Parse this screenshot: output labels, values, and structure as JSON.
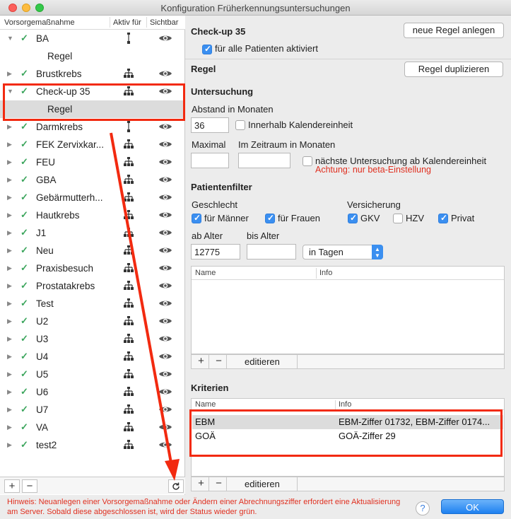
{
  "window": {
    "title": "Konfiguration Früherkennungsuntersuchungen"
  },
  "list_header": {
    "col_name": "Vorsorgemaßnahme",
    "col_active": "Aktiv für",
    "col_visible": "Sichtbar"
  },
  "list_items": [
    {
      "label": "BA",
      "expanded": true,
      "checked": true,
      "active_icon": "single-line-icon",
      "indent": false
    },
    {
      "label": "Regel",
      "child": true
    },
    {
      "label": "Brustkrebs",
      "checked": true,
      "active_icon": "tree-icon"
    },
    {
      "label": "Check-up 35",
      "expanded": true,
      "checked": true,
      "active_icon": "tree-icon"
    },
    {
      "label": "Regel",
      "child": true,
      "selected": true
    },
    {
      "label": "Darmkrebs",
      "checked": true,
      "active_icon": "single-line-icon"
    },
    {
      "label": "FEK Zervixkar...",
      "checked": true,
      "active_icon": "tree-icon"
    },
    {
      "label": "FEU",
      "checked": true,
      "active_icon": "tree-icon"
    },
    {
      "label": "GBA",
      "checked": true,
      "active_icon": "tree-icon"
    },
    {
      "label": "Gebärmutterh...",
      "checked": true,
      "active_icon": "tree-icon"
    },
    {
      "label": "Hautkrebs",
      "checked": true,
      "active_icon": "tree-icon"
    },
    {
      "label": "J1",
      "checked": true,
      "active_icon": "tree-icon"
    },
    {
      "label": "Neu",
      "checked": true,
      "active_icon": "tree-icon"
    },
    {
      "label": "Praxisbesuch",
      "checked": true,
      "active_icon": "tree-icon"
    },
    {
      "label": "Prostatakrebs",
      "checked": true,
      "active_icon": "tree-icon"
    },
    {
      "label": "Test",
      "checked": true,
      "active_icon": "tree-icon"
    },
    {
      "label": "U2",
      "checked": true,
      "active_icon": "tree-icon"
    },
    {
      "label": "U3",
      "checked": true,
      "active_icon": "tree-icon"
    },
    {
      "label": "U4",
      "checked": true,
      "active_icon": "tree-icon"
    },
    {
      "label": "U5",
      "checked": true,
      "active_icon": "tree-icon"
    },
    {
      "label": "U6",
      "checked": true,
      "active_icon": "tree-icon"
    },
    {
      "label": "U7",
      "checked": true,
      "active_icon": "tree-icon"
    },
    {
      "label": "VA",
      "checked": true,
      "active_icon": "tree-icon"
    },
    {
      "label": "test2",
      "checked": true,
      "active_icon": "tree-icon"
    }
  ],
  "list_footer": {
    "add": "+",
    "remove": "−",
    "refresh_icon": "refresh-icon"
  },
  "checkup": {
    "title": "Check-up 35",
    "new_rule_button": "neue Regel anlegen",
    "all_patients_label": "für alle Patienten aktiviert",
    "all_patients_checked": true
  },
  "rule": {
    "title": "Regel",
    "duplicate_button": "Regel duplizieren"
  },
  "exam": {
    "title": "Untersuchung",
    "interval_label": "Abstand in Monaten",
    "interval_value": "36",
    "calendar_unit_label": "Innerhalb Kalendereinheit",
    "calendar_unit_checked": false,
    "max_label": "Maximal",
    "max_value": "",
    "period_label": "Im Zeitraum in Monaten",
    "period_value": "",
    "next_exam_label": "nächste Untersuchung ab Kalendereinheit",
    "next_exam_checked": false,
    "beta_warning": "Achtung: nur beta-Einstellung"
  },
  "patient_filter": {
    "title": "Patientenfilter",
    "gender_label": "Geschlecht",
    "male_label": "für Männer",
    "male_checked": true,
    "female_label": "für Frauen",
    "female_checked": true,
    "insurance_label": "Versicherung",
    "gkv_label": "GKV",
    "gkv_checked": true,
    "hzv_label": "HZV",
    "hzv_checked": false,
    "private_label": "Privat",
    "private_checked": true,
    "age_from_label": "ab Alter",
    "age_from_value": "12775",
    "age_to_label": "bis Alter",
    "age_to_value": "",
    "unit_select": "in Tagen"
  },
  "filter_table": {
    "col_name": "Name",
    "col_info": "Info",
    "rows": [],
    "edit_button": "editieren"
  },
  "criteria": {
    "title": "Kriterien",
    "col_name": "Name",
    "col_info": "Info",
    "rows": [
      {
        "name": "EBM",
        "info": "EBM-Ziffer 01732, EBM-Ziffer 0174...",
        "selected": true
      },
      {
        "name": "GOÄ",
        "info": "GOÄ-Ziffer 29",
        "selected": false
      }
    ],
    "edit_button": "editieren"
  },
  "footer": {
    "hint": "Hinweis: Neuanlegen einer Vorsorgemaßnahme oder Ändern einer Abrechnungsziffer erfordert eine Aktualisierung am Server. Sobald diese abgeschlossen ist, wird der Status wieder grün.",
    "help": "?",
    "ok": "OK"
  },
  "colors": {
    "accent": "#3b8ff0",
    "check_green": "#3ba55c",
    "warning_red": "#e03020",
    "annotation_red": "#f22a10"
  }
}
